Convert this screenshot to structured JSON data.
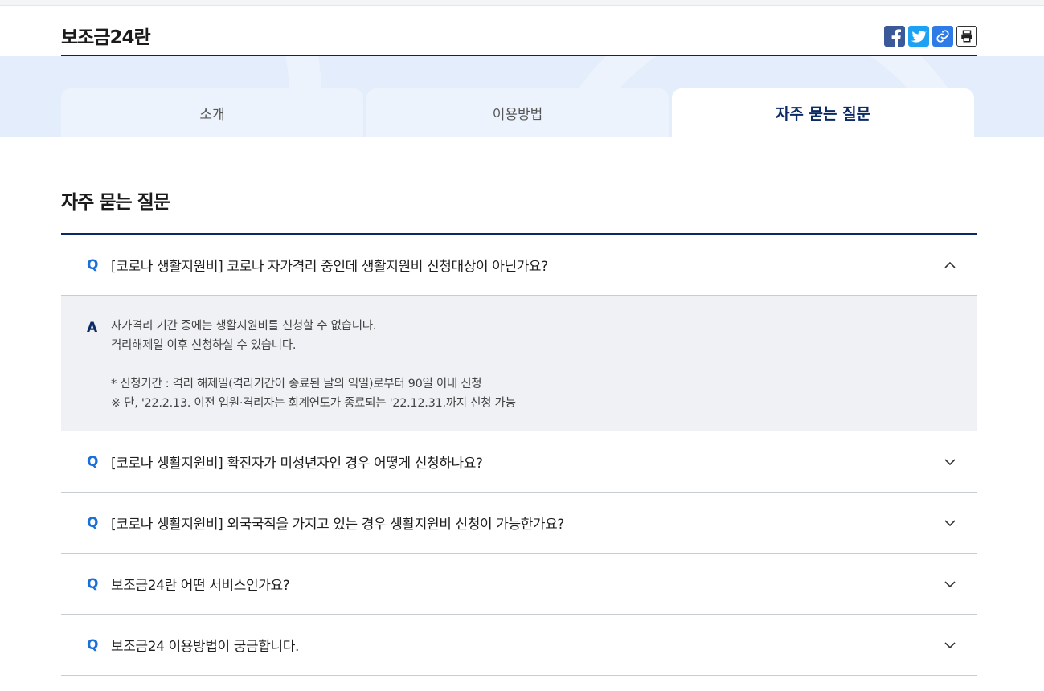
{
  "header": {
    "title": "보조금24란",
    "share_buttons": [
      {
        "name": "facebook",
        "icon": "facebook-icon"
      },
      {
        "name": "twitter",
        "icon": "twitter-icon"
      },
      {
        "name": "link",
        "icon": "link-icon"
      },
      {
        "name": "print",
        "icon": "print-icon"
      }
    ]
  },
  "tabs": [
    {
      "label": "소개",
      "active": false
    },
    {
      "label": "이용방법",
      "active": false
    },
    {
      "label": "자주 묻는 질문",
      "active": true
    }
  ],
  "section_title": "자주 묻는 질문",
  "faq": {
    "q_marker": "Q",
    "a_marker": "A",
    "items": [
      {
        "question": "[코로나 생활지원비] 코로나 자가격리 중인데 생활지원비 신청대상이 아닌가요?",
        "expanded": true,
        "answer_lines": [
          "자가격리 기간 중에는 생활지원비를 신청할 수 없습니다.",
          "격리해제일 이후 신청하실 수 있습니다.",
          "* 신청기간 : 격리 해제일(격리기간이 종료된 날의 익일)로부터 90일 이내 신청",
          "※ 단, '22.2.13. 이전 입원·격리자는 회계연도가 종료되는 '22.12.31.까지 신청 가능"
        ]
      },
      {
        "question": "[코로나 생활지원비] 확진자가 미성년자인 경우 어떻게 신청하나요?",
        "expanded": false
      },
      {
        "question": "[코로나 생활지원비] 외국국적을 가지고 있는 경우 생활지원비 신청이 가능한가요?",
        "expanded": false
      },
      {
        "question": "보조금24란 어떤 서비스인가요?",
        "expanded": false
      },
      {
        "question": "보조금24 이용방법이 궁금합니다.",
        "expanded": false
      }
    ]
  },
  "colors": {
    "navy": "#0b2a63",
    "q_blue": "#1a6fd8",
    "hero_bg": "#e3edfb",
    "answer_bg": "#eff1f4"
  }
}
